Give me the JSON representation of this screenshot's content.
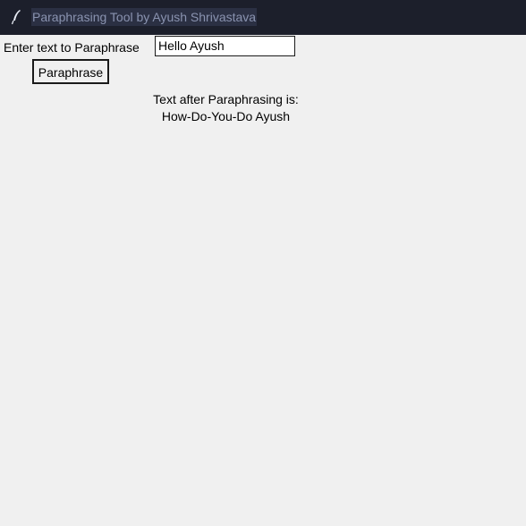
{
  "window": {
    "title": "Paraphrasing Tool by Ayush Shrivastava",
    "icon": "feather-icon"
  },
  "form": {
    "input_label": "Enter text to Paraphrase",
    "input_value": "Hello Ayush",
    "button_label": "Paraphrase"
  },
  "result": {
    "label": "Text after Paraphrasing is:",
    "value": "How-Do-You-Do Ayush"
  },
  "colors": {
    "titlebar_bg": "#1c1f2b",
    "title_highlight": "#2b3043",
    "title_text": "#8a93b0",
    "window_bg": "#f0f0f0"
  }
}
